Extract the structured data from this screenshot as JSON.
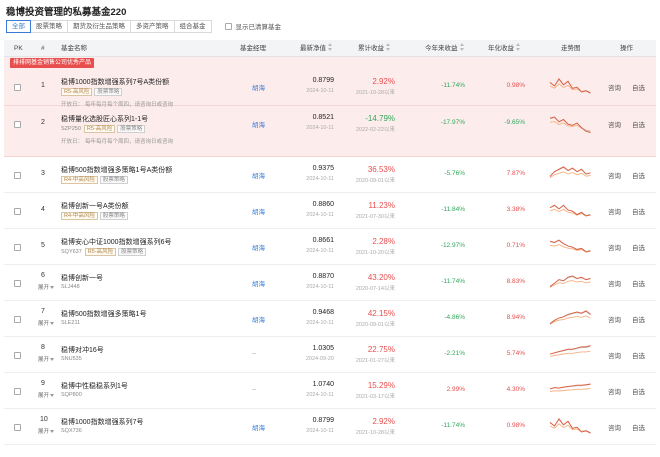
{
  "page_title": "稳博投资管理的私募基金220",
  "filters": {
    "tabs": [
      "全部",
      "股票策略",
      "期货及衍生品策略",
      "多资产策略",
      "组合基金"
    ],
    "active_index": 0,
    "show_cleared_label": "显示已清算基金"
  },
  "table": {
    "headers": {
      "pk": "PK",
      "index": "#",
      "name": "基金名称",
      "manager": "基金经理",
      "nav": "最新净值",
      "cumulative": "累计收益",
      "ytd": "今年来收益",
      "annualized": "年化收益",
      "trend": "走势图",
      "actions": "操作"
    },
    "banner_label": "排排网基金销售公司优秀产品",
    "consult_label": "咨询",
    "watch_label": "自选",
    "rows": [
      {
        "index": "1",
        "name": "稳博1000指数增强系列7号A类份额",
        "code": "",
        "tags": [
          "R5-高风险",
          "股票策略"
        ],
        "open": "开放日：",
        "open_value": "每年每月每个周四，请咨询日或咨询",
        "manager": "胡海",
        "nav": "0.8799",
        "nav_date": "2024-10-11",
        "cum": "2.92%",
        "cum_date": "2021-10-28以来",
        "ytd": "-11.74%",
        "ann": "0.98%",
        "highlight": true
      },
      {
        "index": "2",
        "name": "稳博量化选股匠心系列1-1号",
        "code": "SZP250",
        "tags": [
          "R5-高风险",
          "股票策略"
        ],
        "open": "开放日：",
        "open_value": "每年每月每个周四，请咨询日或咨询",
        "manager": "胡海",
        "nav": "0.8521",
        "nav_date": "2024-10-11",
        "cum": "-14.79%",
        "cum_date": "2022-02-22以来",
        "ytd": "-17.97%",
        "ann": "-9.65%",
        "highlight": true
      },
      {
        "index": "3",
        "name": "稳博500指数增强多策略1号A类份额",
        "code": "",
        "tags": [
          "R4-中高风险",
          "股票策略"
        ],
        "manager": "胡海",
        "nav": "0.9375",
        "nav_date": "2024-10-11",
        "cum": "36.53%",
        "cum_date": "2020-09-01以来",
        "ytd": "-5.76%",
        "ann": "7.87%",
        "highlight": false
      },
      {
        "index": "4",
        "name": "稳博创新一号A类份额",
        "code": "",
        "tags": [
          "R4-中高风险",
          "股票策略"
        ],
        "manager": "胡海",
        "nav": "0.8860",
        "nav_date": "2024-10-11",
        "cum": "11.23%",
        "cum_date": "2021-07-30以来",
        "ytd": "-11.84%",
        "ann": "3.38%",
        "highlight": false
      },
      {
        "index": "5",
        "name": "稳博安心中证1000指数增强系列6号",
        "code": "SQY637",
        "tags": [
          "R5-高风险",
          "股票策略"
        ],
        "manager": "胡海",
        "nav": "0.8661",
        "nav_date": "2024-10-11",
        "cum": "2.28%",
        "cum_date": "2021-10-20以来",
        "ytd": "-12.97%",
        "ann": "0.71%",
        "highlight": false
      },
      {
        "index": "6",
        "name": "稳博创新一号",
        "code": "SLJ448",
        "tags": [],
        "fixed": true,
        "manager": "胡海",
        "nav": "0.8870",
        "nav_date": "2024-10-11",
        "cum": "43.20%",
        "cum_date": "2020-07-14以来",
        "ytd": "-11.74%",
        "ann": "8.83%",
        "highlight": false
      },
      {
        "index": "7",
        "name": "稳博500指数增强多策略1号",
        "code": "SLE211",
        "tags": [],
        "fixed": true,
        "manager": "胡海",
        "nav": "0.9468",
        "nav_date": "2024-10-11",
        "cum": "42.15%",
        "cum_date": "2020-09-01以来",
        "ytd": "-4.86%",
        "ann": "8.94%",
        "highlight": false
      },
      {
        "index": "8",
        "name": "稳博对冲16号",
        "code": "SNU535",
        "tags": [],
        "fixed": true,
        "manager": "--",
        "nav": "1.0305",
        "nav_date": "2024-09-20",
        "cum": "22.75%",
        "cum_date": "2021-01-27以来",
        "ytd": "-2.21%",
        "ann": "5.74%",
        "highlight": false
      },
      {
        "index": "9",
        "name": "稳博中性稳稳系列1号",
        "code": "SQP800",
        "tags": [],
        "fixed": true,
        "manager": "--",
        "nav": "1.0740",
        "nav_date": "2024-10-11",
        "cum": "15.29%",
        "cum_date": "2021-03-17以来",
        "ytd": "2.99%",
        "ann": "4.30%",
        "highlight": false
      },
      {
        "index": "10",
        "name": "稳博1000指数增强系列7号",
        "code": "SQX736",
        "tags": [],
        "fixed": true,
        "manager": "胡海",
        "nav": "0.8799",
        "nav_date": "2024-10-11",
        "cum": "2.92%",
        "cum_date": "2021-10-28以来",
        "ytd": "-11.74%",
        "ann": "0.98%",
        "highlight": false
      }
    ],
    "fixed_label": "展开"
  },
  "colors": {
    "up": "#e94e4e",
    "down": "#2fa95a",
    "accent": "#3a7bd5",
    "banner": "#e94e4e",
    "highlight_bg": "#fdecec"
  }
}
